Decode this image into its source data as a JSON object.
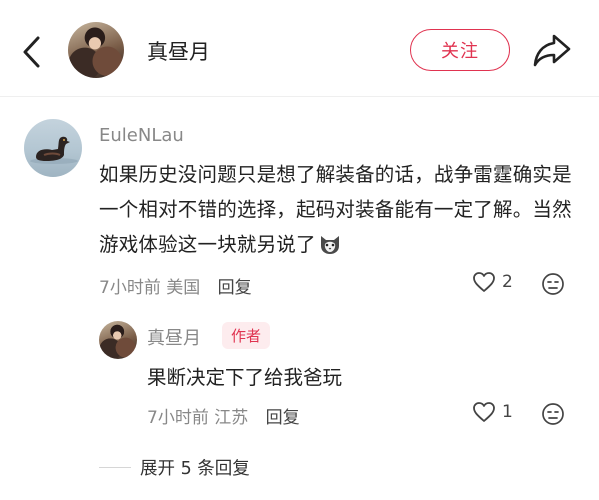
{
  "header": {
    "author_name": "真昼月",
    "follow_label": "关注"
  },
  "comment": {
    "username": "EuleNLau",
    "text": "如果历史没问题只是想了解装备的话，战争雷霆确实是一个相对不错的选择，起码对装备能有一定了解。当然游戏体验这一块就另说了",
    "emoji": "cat-face-emoji",
    "time": "7小时前",
    "location": "美国",
    "reply_label": "回复",
    "like_count": "2"
  },
  "reply": {
    "username": "真昼月",
    "badge": "作者",
    "text": "果断决定下了给我爸玩",
    "time": "7小时前",
    "location": "江苏",
    "reply_label": "回复",
    "like_count": "1"
  },
  "expand": {
    "label": "展开 5 条回复"
  },
  "colors": {
    "accent": "#e03350",
    "muted_text": "#888888",
    "body_text": "#222222"
  },
  "icons": [
    "back-arrow-icon",
    "share-icon",
    "heart-icon",
    "dislike-face-icon"
  ]
}
